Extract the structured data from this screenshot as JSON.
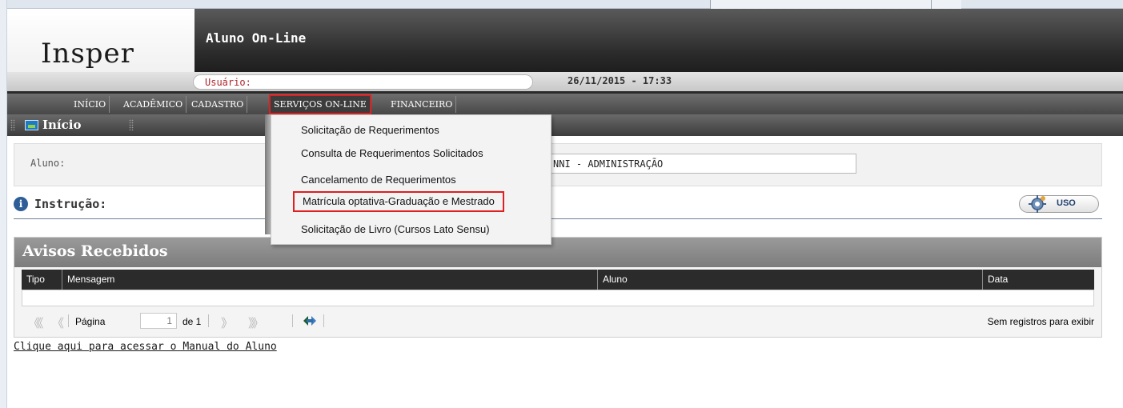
{
  "brand": {
    "logo": "Insper"
  },
  "header": {
    "app_title": "Aluno On-Line",
    "user_label": "Usuário:",
    "user_value": "",
    "datetime": "26/11/2015 - 17:33"
  },
  "nav": {
    "items": [
      {
        "label": "INÍCIO"
      },
      {
        "label": "ACADÊMICO"
      },
      {
        "label": "CADASTRO"
      },
      {
        "label": "SERVIÇOS ON-LINE",
        "active": true
      },
      {
        "label": "FINANCEIRO"
      }
    ]
  },
  "breadcrumb": {
    "title": "Início"
  },
  "dropdown": {
    "items": [
      {
        "label": "Solicitação de Requerimentos"
      },
      {
        "label": "Consulta de Requerimentos Solicitados"
      },
      {
        "label": "Cancelamento de Requerimentos"
      },
      {
        "label": "Matrícula optativa-Graduação e Mestrado",
        "highlighted": true
      },
      {
        "label": "Solicitação de Livro (Cursos Lato Sensu)"
      }
    ]
  },
  "aluno": {
    "label": "Aluno:",
    "value": "NNI - ADMINISTRAÇÃO"
  },
  "instruction": {
    "title": "Instrução:",
    "uso_label": "USO"
  },
  "avisos": {
    "title": "Avisos Recebidos",
    "columns": [
      "Tipo",
      "Mensagem",
      "Aluno",
      "Data"
    ],
    "rows": [],
    "pager": {
      "page_label": "Página",
      "page_value": "1",
      "of_label": "de 1",
      "empty_text": "Sem registros para exibir"
    }
  },
  "manual_link": "Clique aqui para acessar o Manual do Aluno",
  "colors": {
    "highlight_border": "#e02020",
    "header_dark": "#2b2b2b",
    "user_label": "#b0262c"
  }
}
